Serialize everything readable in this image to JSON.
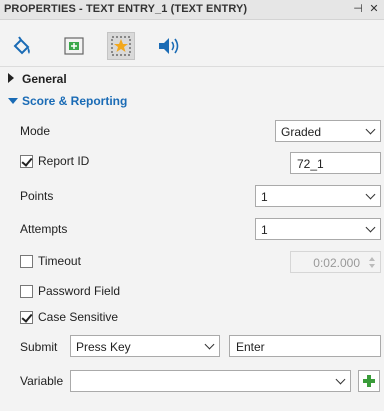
{
  "panel": {
    "title": "PROPERTIES - TEXT ENTRY_1 (TEXT ENTRY)",
    "pin_icon": "pin-icon",
    "close_icon": "close-icon"
  },
  "tabs": [
    {
      "icon": "paint-bucket-icon",
      "active": false
    },
    {
      "icon": "move-position-icon",
      "active": false
    },
    {
      "icon": "star-interaction-icon",
      "active": true
    },
    {
      "icon": "audio-speaker-icon",
      "active": false
    }
  ],
  "sections": {
    "general": "General",
    "score_reporting": "Score & Reporting"
  },
  "fields": {
    "mode_label": "Mode",
    "mode_value": "Graded",
    "report_id_label": "Report ID",
    "report_id_checked": true,
    "report_id_value": "72_1",
    "points_label": "Points",
    "points_value": "1",
    "attempts_label": "Attempts",
    "attempts_value": "1",
    "timeout_label": "Timeout",
    "timeout_checked": false,
    "timeout_value": "0:02.000",
    "password_label": "Password Field",
    "password_checked": false,
    "case_label": "Case Sensitive",
    "case_checked": true,
    "submit_label": "Submit",
    "submit_value": "Press Key",
    "submit_key": "Enter",
    "variable_label": "Variable",
    "variable_value": ""
  },
  "colors": {
    "accent": "#1a6bb5",
    "add_green": "#3a9c3a"
  }
}
